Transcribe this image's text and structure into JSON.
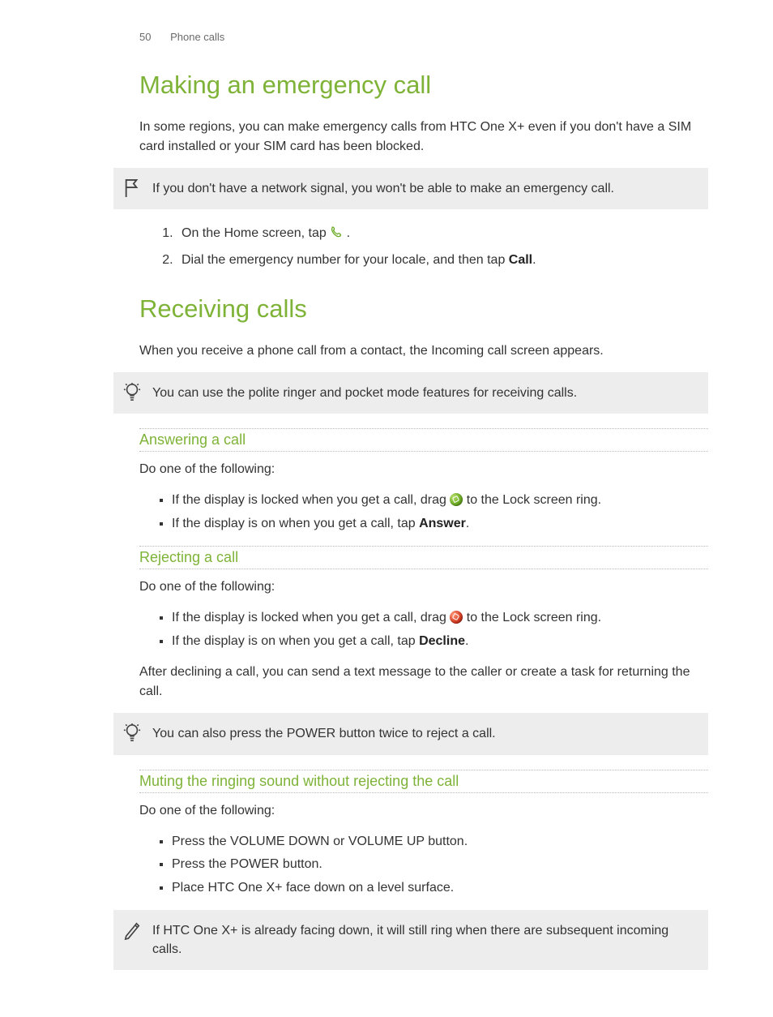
{
  "header": {
    "page_number": "50",
    "section": "Phone calls"
  },
  "section1": {
    "title": "Making an emergency call",
    "intro": "In some regions, you can make emergency calls from HTC One X+ even if you don't have a SIM card installed or your SIM card has been blocked.",
    "note_flag": "If you don't have a network signal, you won't be able to make an emergency call.",
    "step1_pre": "On the Home screen, tap ",
    "step1_post": ".",
    "step2_pre": "Dial the emergency number for your locale, and then tap ",
    "step2_bold": "Call",
    "step2_post": "."
  },
  "section2": {
    "title": "Receiving calls",
    "intro": "When you receive a phone call from a contact, the Incoming call screen appears.",
    "tip1": "You can use the polite ringer and pocket mode features for receiving calls.",
    "answering": {
      "title": "Answering a call",
      "lead": "Do one of the following:",
      "b1_pre": "If the display is locked when you get a call, drag ",
      "b1_post": " to the Lock screen ring.",
      "b2_pre": "If the display is on when you get a call, tap ",
      "b2_bold": "Answer",
      "b2_post": "."
    },
    "rejecting": {
      "title": "Rejecting a call",
      "lead": "Do one of the following:",
      "b1_pre": "If the display is locked when you get a call, drag ",
      "b1_post": " to the Lock screen ring.",
      "b2_pre": "If the display is on when you get a call, tap ",
      "b2_bold": "Decline",
      "b2_post": ".",
      "after": "After declining a call, you can send a text message to the caller or create a task for returning the call.",
      "tip2": "You can also press the POWER button twice to reject a call."
    },
    "muting": {
      "title": "Muting the ringing sound without rejecting the call",
      "lead": "Do one of the following:",
      "b1": "Press the VOLUME DOWN or VOLUME UP button.",
      "b2": "Press the POWER button.",
      "b3": "Place HTC One X+ face down on a level surface.",
      "note": "If HTC One X+ is already facing down, it will still ring when there are subsequent incoming calls."
    }
  }
}
